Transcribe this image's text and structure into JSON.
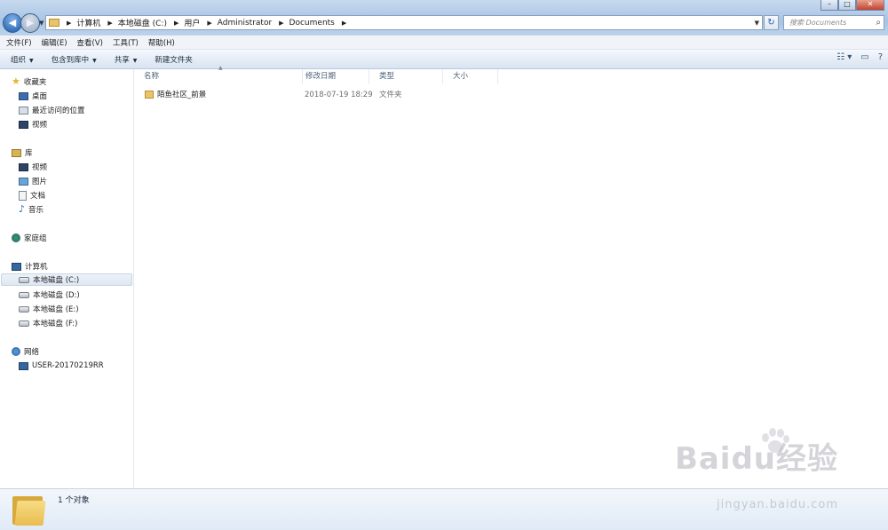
{
  "address_bar": {
    "crumbs": [
      "计算机",
      "本地磁盘 (C:)",
      "用户",
      "Administrator",
      "Documents"
    ],
    "search_placeholder": "搜索 Documents"
  },
  "menu": [
    "文件(F)",
    "编辑(E)",
    "查看(V)",
    "工具(T)",
    "帮助(H)"
  ],
  "commands": {
    "organize": "组织",
    "include_library": "包含到库中",
    "share": "共享",
    "new_folder": "新建文件夹"
  },
  "nav": {
    "favorites": {
      "label": "收藏夹",
      "items": [
        "桌面",
        "最近访问的位置",
        "视频"
      ]
    },
    "libraries": {
      "label": "库",
      "items": [
        "视频",
        "图片",
        "文档",
        "音乐"
      ]
    },
    "homegroup": "家庭组",
    "computer": {
      "label": "计算机",
      "items": [
        "本地磁盘 (C:)",
        "本地磁盘 (D:)",
        "本地磁盘 (E:)",
        "本地磁盘 (F:)"
      ]
    },
    "network": {
      "label": "网络",
      "items": [
        "USER-20170219RR"
      ]
    }
  },
  "columns": {
    "name": "名称",
    "modified": "修改日期",
    "type": "类型",
    "size": "大小"
  },
  "files": [
    {
      "name": "陌鱼社区_前景",
      "modified": "2018-07-19 18:29",
      "type": "文件夹",
      "size": ""
    }
  ],
  "details": {
    "count": "1 个对象"
  },
  "watermark": {
    "brand": "Baidu经验",
    "url": "jingyan.baidu.com"
  }
}
